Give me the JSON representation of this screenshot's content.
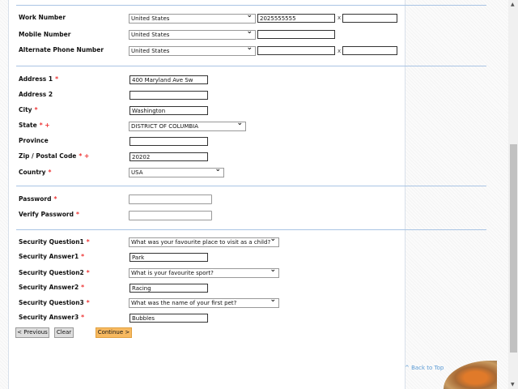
{
  "phone": {
    "work": {
      "label": "Work Number",
      "country": "United States",
      "number": "2025555555",
      "ext": "",
      "ext_sep": "x"
    },
    "mobile": {
      "label": "Mobile Number",
      "country": "United States",
      "number": ""
    },
    "alternate": {
      "label": "Alternate Phone Number",
      "country": "United States",
      "number": "",
      "ext": "",
      "ext_sep": "x"
    }
  },
  "address": {
    "address1": {
      "label": "Address 1",
      "req": "*",
      "value": "400 Maryland Ave Sw"
    },
    "address2": {
      "label": "Address 2",
      "value": ""
    },
    "city": {
      "label": "City",
      "req": "*",
      "value": "Washington"
    },
    "state": {
      "label": "State",
      "req": "* +",
      "value": "DISTRICT OF COLUMBIA"
    },
    "province": {
      "label": "Province",
      "value": ""
    },
    "zip": {
      "label": "Zip / Postal Code",
      "req": "* +",
      "value": "20202"
    },
    "country": {
      "label": "Country",
      "req": "*",
      "value": "USA"
    }
  },
  "password": {
    "password": {
      "label": "Password",
      "req": "*",
      "value": ""
    },
    "verify": {
      "label": "Verify Password",
      "req": "*",
      "value": ""
    }
  },
  "security": {
    "q1": {
      "label": "Security Question1",
      "req": "*",
      "value": "What was your favourite place to visit as a child?"
    },
    "a1": {
      "label": "Security Answer1",
      "req": "*",
      "value": "Park"
    },
    "q2": {
      "label": "Security Question2",
      "req": "*",
      "value": "What is your favourite sport?"
    },
    "a2": {
      "label": "Security Answer2",
      "req": "*",
      "value": "Racing"
    },
    "q3": {
      "label": "Security Question3",
      "req": "*",
      "value": "What was the name of your first pet?"
    },
    "a3": {
      "label": "Security Answer3",
      "req": "*",
      "value": "Bubbles"
    }
  },
  "buttons": {
    "previous": "< Previous",
    "clear": "Clear",
    "continue": "Continue >"
  },
  "back_to_top": "^ Back to Top",
  "colors": {
    "accent": "#f7b960",
    "rule": "#a9c4e4",
    "required": "#e33333",
    "link": "#5b9bd5"
  }
}
